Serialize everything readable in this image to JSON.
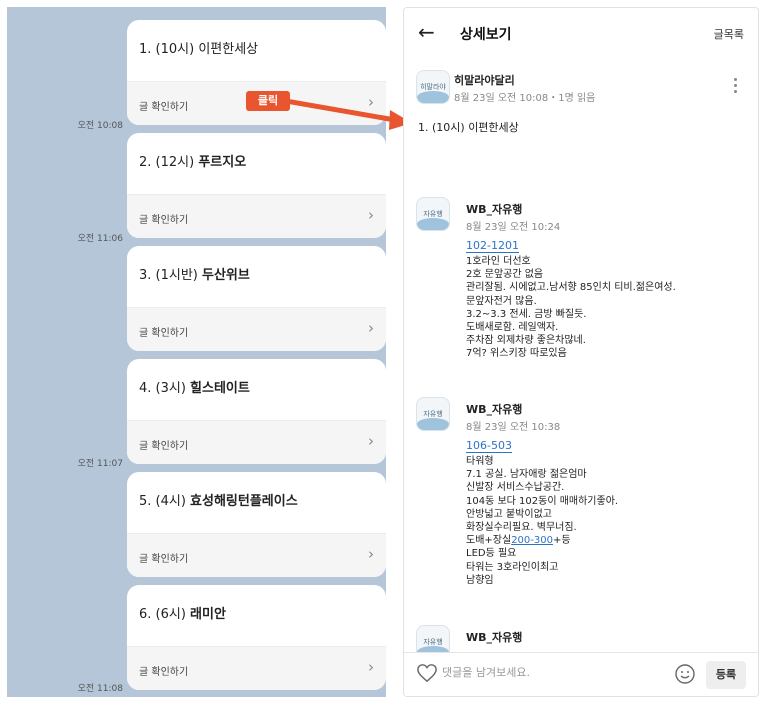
{
  "chat": {
    "cards": [
      {
        "num": "1. (10시) ",
        "name": "이편한세상",
        "bold": false,
        "action": "글 확인하기",
        "time": "오전 10:08"
      },
      {
        "num": "2. (12시) ",
        "name": "푸르지오",
        "bold": true,
        "action": "글 확인하기",
        "time": "오전 11:06"
      },
      {
        "num": "3. (1시반) ",
        "name": "두산위브",
        "bold": true,
        "action": "글 확인하기",
        "time": ""
      },
      {
        "num": "4. (3시) ",
        "name": "힐스테이트",
        "bold": true,
        "action": "글 확인하기",
        "time": "오전 11:07"
      },
      {
        "num": "5. (4시) ",
        "name": "효성해링턴플레이스",
        "bold": true,
        "action": "글 확인하기",
        "time": ""
      },
      {
        "num": "6. (6시) ",
        "name": "래미안",
        "bold": true,
        "action": "글 확인하기",
        "time": "오전 11:08"
      }
    ],
    "annotation_label": "클릭",
    "annotation_color": "#e8552e"
  },
  "detail": {
    "header": {
      "title": "상세보기",
      "list_link": "글목록",
      "back_icon": "arrow-left-icon"
    },
    "post": {
      "avatar_text": "히말라야달리",
      "author": "히말라야달리",
      "meta": "8월 23일 오전 10:08・1명 읽음",
      "body": "1. (10시) 이편한세상"
    },
    "comments": [
      {
        "avatar_text": "자유행",
        "author": "WB_자유행",
        "meta": "8월 23일 오전 10:24",
        "link": "102-1201",
        "lines": [
          "1호라인 더선호",
          "2호 문앞공간 없음",
          "관리잘됨. 시에없고.남서향 85인치 티비.젊은여성.",
          "문앞자전거 많음.",
          "3.2~3.3 전세. 금방 빠질듯.",
          "도배새로함. 레일액자.",
          "주차잠 외제차량 좋은차많네.",
          "7억? 위스키장 따로있음"
        ]
      },
      {
        "avatar_text": "자유행",
        "author": "WB_자유행",
        "meta": "8월 23일 오전 10:38",
        "link": "106-503",
        "lines": [
          "타워형",
          "7.1 공실. 남자애랑 젊은엄마",
          "신발장 서비스수납공간.",
          "104동 보다 102동이 매매하기좋아.",
          "안방넓고 붙박이없고",
          "화장실수리필요. 벽무너짐."
        ],
        "line_mixed": {
          "pre": "도배+장실",
          "link": "200-300",
          "post": "+등"
        },
        "lines_after": [
          "LED등 필요",
          "타워는 3호라인이최고",
          "남향임"
        ]
      },
      {
        "avatar_text": "자유행",
        "author": "WB_자유행"
      }
    ],
    "bottom": {
      "placeholder": "댓글을 남겨보세요.",
      "submit": "등록"
    }
  }
}
